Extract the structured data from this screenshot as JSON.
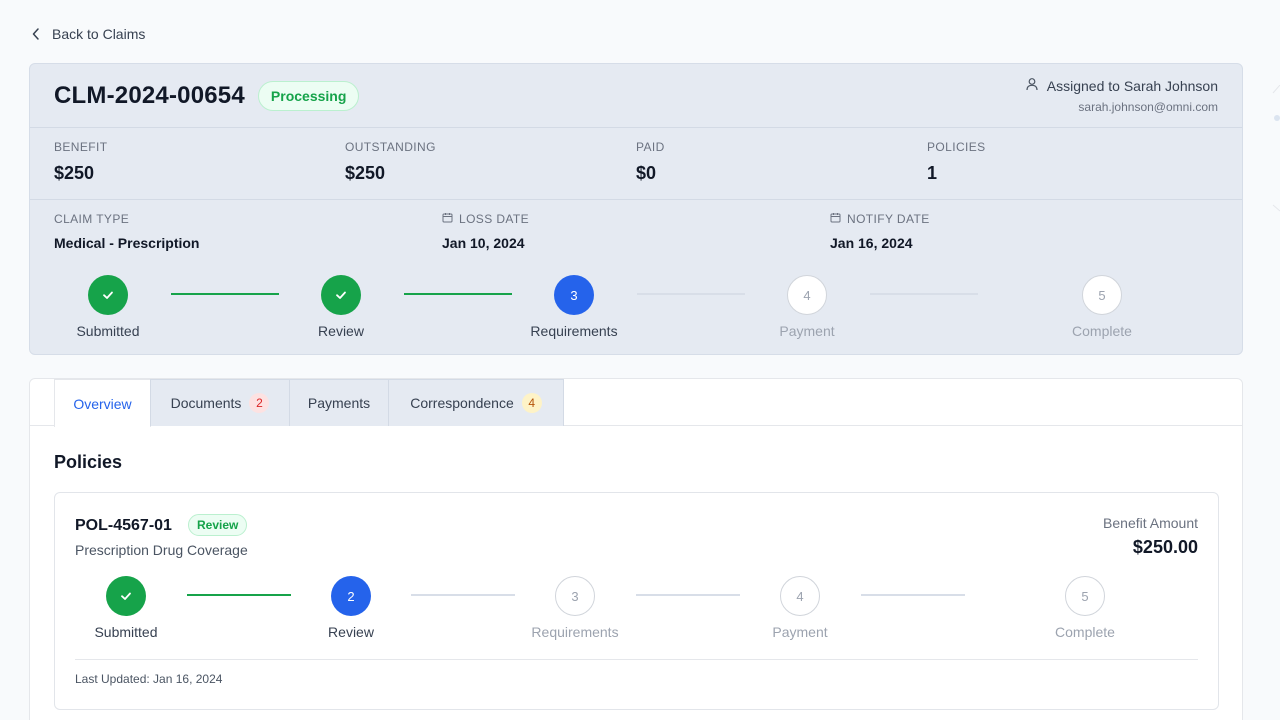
{
  "nav": {
    "back_label": "Back to Claims"
  },
  "claim": {
    "id": "CLM-2024-00654",
    "status": "Processing",
    "assigned_label": "Assigned to Sarah Johnson",
    "assigned_email": "sarah.johnson@omni.com"
  },
  "stats": [
    {
      "label": "BENEFIT",
      "value": "$250"
    },
    {
      "label": "OUTSTANDING",
      "value": "$250"
    },
    {
      "label": "PAID",
      "value": "$0"
    },
    {
      "label": "POLICIES",
      "value": "1"
    }
  ],
  "info": [
    {
      "label": "CLAIM TYPE",
      "value": "Medical - Prescription",
      "icon": ""
    },
    {
      "label": "LOSS DATE",
      "value": "Jan 10, 2024",
      "icon": "calendar-icon"
    },
    {
      "label": "NOTIFY DATE",
      "value": "Jan 16, 2024",
      "icon": "calendar-icon"
    }
  ],
  "claim_steps": [
    {
      "number": "1",
      "label": "Submitted",
      "state": "done"
    },
    {
      "number": "2",
      "label": "Review",
      "state": "done"
    },
    {
      "number": "3",
      "label": "Requirements",
      "state": "active"
    },
    {
      "number": "4",
      "label": "Payment",
      "state": "todo"
    },
    {
      "number": "5",
      "label": "Complete",
      "state": "todo"
    }
  ],
  "tabs": [
    {
      "label": "Overview",
      "badge": "",
      "active": true
    },
    {
      "label": "Documents",
      "badge": "2",
      "badge_color": "red"
    },
    {
      "label": "Payments",
      "badge": ""
    },
    {
      "label": "Correspondence",
      "badge": "4",
      "badge_color": "yellow"
    }
  ],
  "section_title": "Policies",
  "policy": {
    "id": "POL-4567-01",
    "status": "Review",
    "description": "Prescription Drug Coverage",
    "amount_label": "Benefit Amount",
    "amount": "$250.00",
    "last_updated": "Last Updated: Jan 16, 2024",
    "steps": [
      {
        "number": "1",
        "label": "Submitted",
        "state": "done"
      },
      {
        "number": "2",
        "label": "Review",
        "state": "active"
      },
      {
        "number": "3",
        "label": "Requirements",
        "state": "todo"
      },
      {
        "number": "4",
        "label": "Payment",
        "state": "todo"
      },
      {
        "number": "5",
        "label": "Complete",
        "state": "todo"
      }
    ]
  },
  "colors": {
    "done": "#16a34a",
    "active": "#2563eb",
    "todo": "#d8dee8"
  }
}
